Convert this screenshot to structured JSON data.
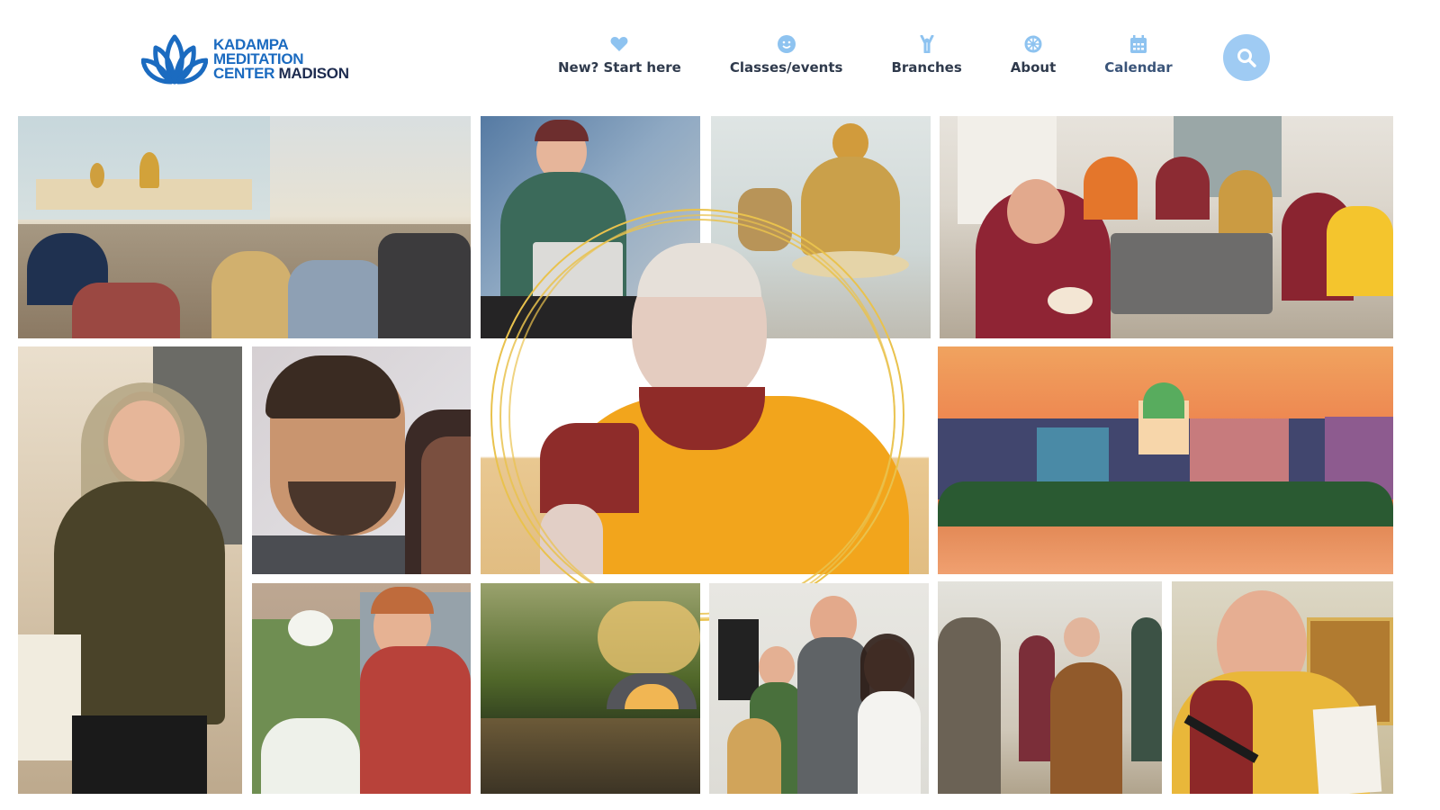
{
  "logo": {
    "line1": "KADAMPA",
    "line2": "MEDITATION",
    "line3_part1": "CENTER",
    "line3_part2": "MADISON",
    "icon": "lotus-icon"
  },
  "nav": {
    "items": [
      {
        "label": "New? Start here",
        "icon": "heart-icon"
      },
      {
        "label": "Classes/events",
        "icon": "smile-icon"
      },
      {
        "label": "Branches",
        "icon": "person-arms-up-icon"
      },
      {
        "label": "About",
        "icon": "dharma-wheel-icon"
      },
      {
        "label": "Calendar",
        "icon": "calendar-icon"
      }
    ]
  },
  "search": {
    "icon": "search-icon"
  },
  "colors": {
    "brand_blue": "#1b6bc0",
    "brand_dark": "#1d2b4f",
    "nav_icon": "#8ec3f0",
    "search_bg": "#9fcbf3",
    "ring_gold": "#e9c24d"
  },
  "gallery": {
    "photos": [
      "meditation-hall-photo",
      "woman-at-desk-photo",
      "buddha-statue-photo",
      "group-meal-photo",
      "woman-smiling-photo",
      "man-profile-photo",
      "teacher-portrait-photo",
      "city-skyline-sunset-photo",
      "woman-flowers-photo",
      "river-bridge-photo",
      "three-people-photo",
      "gathering-photo",
      "monk-speaking-photo"
    ]
  }
}
